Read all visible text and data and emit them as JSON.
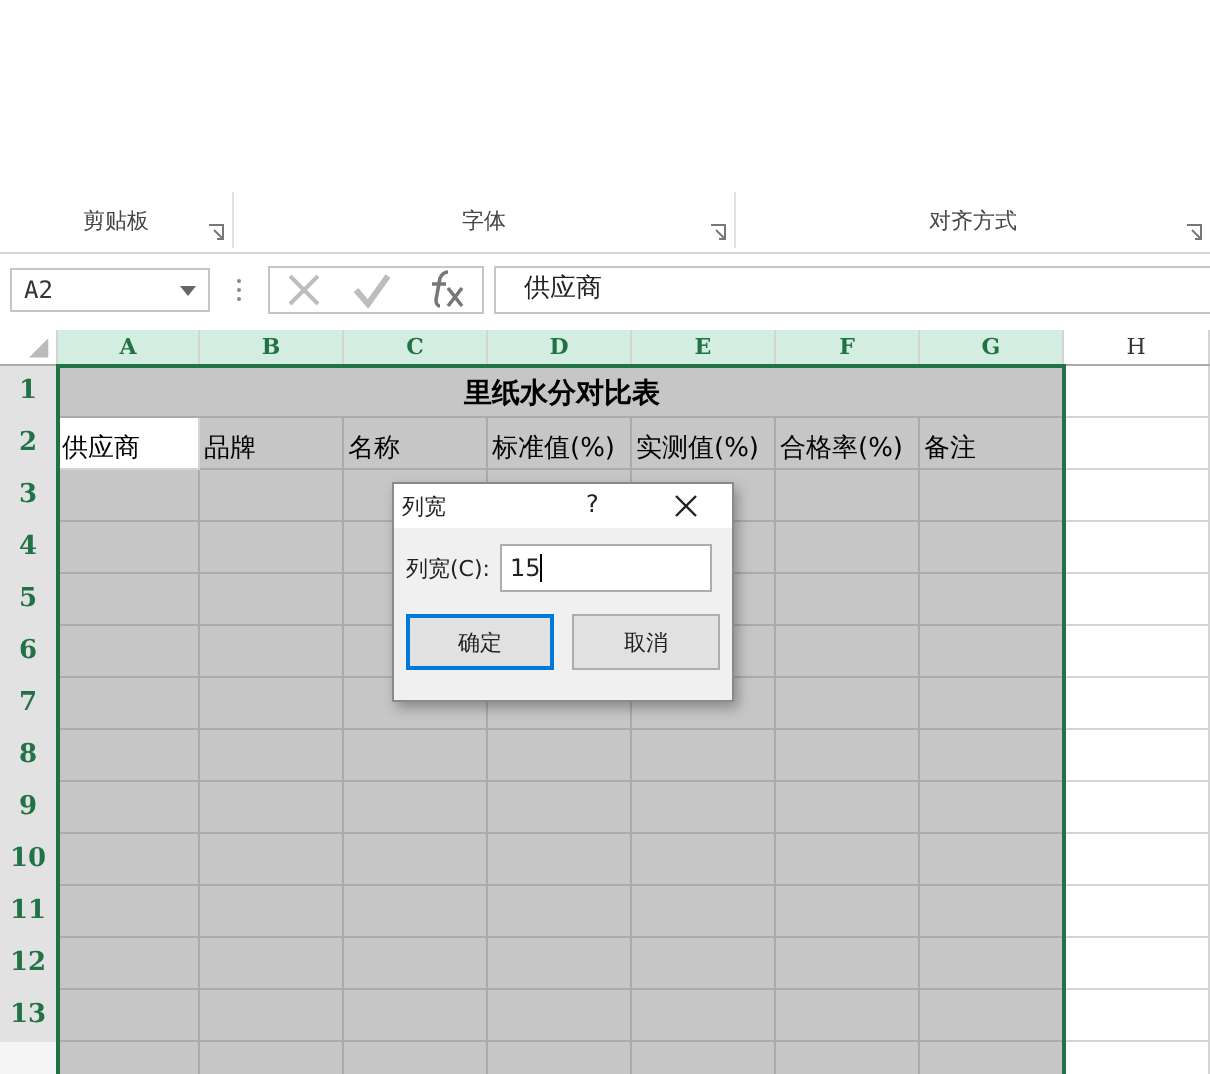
{
  "ribbon_groups": [
    {
      "label": "剪贴板",
      "launcher": true
    },
    {
      "label": "字体",
      "launcher": true
    },
    {
      "label": "对齐方式",
      "launcher": true
    }
  ],
  "formula_bar": {
    "name_box": "A2",
    "formula": "供应商"
  },
  "columns": [
    {
      "label": "A",
      "selected": true
    },
    {
      "label": "B",
      "selected": true
    },
    {
      "label": "C",
      "selected": true
    },
    {
      "label": "D",
      "selected": true
    },
    {
      "label": "E",
      "selected": true
    },
    {
      "label": "F",
      "selected": true
    },
    {
      "label": "G",
      "selected": true
    },
    {
      "label": "H",
      "selected": false
    }
  ],
  "rows": [
    {
      "label": "1",
      "selected": true
    },
    {
      "label": "2",
      "selected": true
    },
    {
      "label": "3",
      "selected": true
    },
    {
      "label": "4",
      "selected": true
    },
    {
      "label": "5",
      "selected": true
    },
    {
      "label": "6",
      "selected": true
    },
    {
      "label": "7",
      "selected": true
    },
    {
      "label": "8",
      "selected": true
    },
    {
      "label": "9",
      "selected": true
    },
    {
      "label": "10",
      "selected": true
    },
    {
      "label": "11",
      "selected": true
    },
    {
      "label": "12",
      "selected": true
    },
    {
      "label": "13",
      "selected": true
    }
  ],
  "title": "里纸水分对比表",
  "header_cells": [
    {
      "text": "供应商",
      "active": true
    },
    {
      "text": "品牌",
      "active": false
    },
    {
      "text": "名称",
      "active": false
    },
    {
      "text": "标准值(%)",
      "active": false
    },
    {
      "text": "实测值(%)",
      "active": false
    },
    {
      "text": "合格率(%)",
      "active": false
    },
    {
      "text": "备注",
      "active": false
    }
  ],
  "dialog": {
    "title": "列宽",
    "help": "?",
    "label": "列宽(C):",
    "value": "15",
    "buttons": [
      {
        "label": "确定",
        "default": true
      },
      {
        "label": "取消",
        "default": false
      }
    ]
  }
}
